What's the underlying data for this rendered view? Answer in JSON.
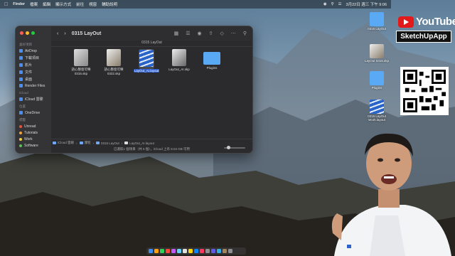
{
  "menubar": {
    "app": "Finder",
    "items": [
      "檔案",
      "編輯",
      "顯示方式",
      "前往",
      "視窗",
      "輔助說明"
    ],
    "datetime": "3月22日 週三 下午 9:06"
  },
  "finder": {
    "title": "0315 LayOut",
    "path_title": "0315 LayOut",
    "sidebar": {
      "favorites_header": "喜好項目",
      "favorites": [
        "AirDrop",
        "下載項目",
        "影片",
        "文件",
        "桌面",
        "Render Files"
      ],
      "icloud_header": "iCloud",
      "icloud": [
        "iCloud 雲碟"
      ],
      "locations_header": "位置",
      "locations": [
        "OneDrive"
      ],
      "tags_header": "標籤",
      "tags": [
        {
          "label": "Unread",
          "color": "#e5533c"
        },
        {
          "label": "Tutorials",
          "color": "#f2a43a"
        },
        {
          "label": "Work",
          "color": "#f4d03f"
        },
        {
          "label": "Software",
          "color": "#58c159"
        }
      ]
    },
    "files": [
      {
        "name": "語心整窗可樂0315.skp",
        "kind": "skp",
        "selected": false
      },
      {
        "name": "語心整窗可樂0322.skp",
        "kind": "skp",
        "selected": false
      },
      {
        "name": "LayOut_AI.layout",
        "kind": "layout",
        "selected": true
      },
      {
        "name": "LayOut_AI.skp",
        "kind": "skp",
        "selected": false
      },
      {
        "name": "Plugins",
        "kind": "folder",
        "selected": false
      }
    ],
    "breadcrumb": [
      "iCloud 雲碟",
      "課程",
      "0315 LayOut",
      "LayOut_AI.layout"
    ],
    "status": "已選取1 個項目（共 5 個），iCloud 上有 8.04 GB 可用"
  },
  "desktop_icons": [
    {
      "label": "0315 LayOut",
      "kind": "folder"
    },
    {
      "label": "LayOut 0315.skp",
      "kind": "skp"
    },
    {
      "label": "Plugins",
      "kind": "folder"
    },
    {
      "label": "0315 LayOut Work.layout",
      "kind": "layout"
    }
  ],
  "branding": {
    "youtube": "YouTube",
    "channel": "SketchUpApp"
  },
  "colors": {
    "accent": "#2f5fd0",
    "folder": "#5aa9f5",
    "youtube_red": "#e21a1a"
  }
}
